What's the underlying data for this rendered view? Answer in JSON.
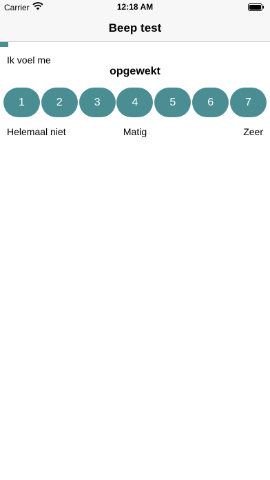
{
  "status_bar": {
    "carrier": "Carrier",
    "time": "12:18 AM",
    "wifi_icon": "wifi-icon",
    "battery_icon": "battery-icon"
  },
  "nav": {
    "title": "Beep test"
  },
  "progress": {
    "fraction": 0.03,
    "color": "#4a8e94"
  },
  "question": {
    "prompt": "Ik voel me",
    "state": "opgewekt"
  },
  "scale": {
    "options": [
      "1",
      "2",
      "3",
      "4",
      "5",
      "6",
      "7"
    ],
    "button_color": "#4a8e94",
    "low_label": "Helemaal niet",
    "mid_label": "Matig",
    "high_label": "Zeer"
  }
}
